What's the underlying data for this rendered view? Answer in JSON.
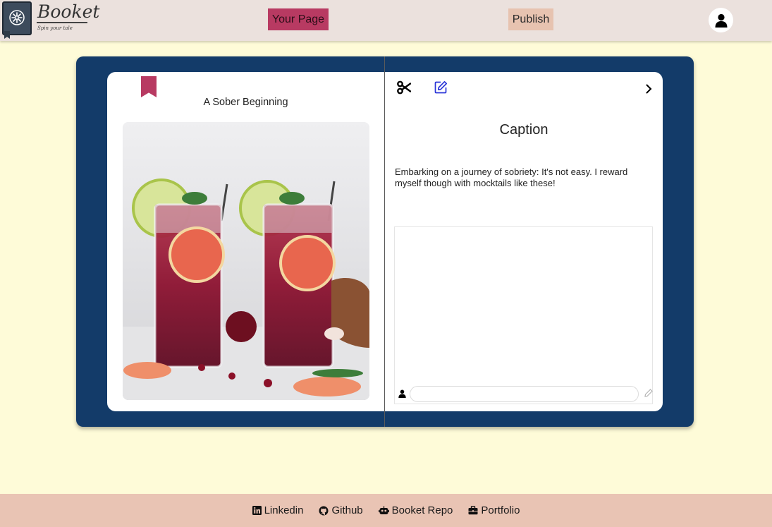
{
  "header": {
    "logo_title": "Booket",
    "logo_tagline": "Spin your tale",
    "your_page_label": "Your Page",
    "publish_label": "Publish"
  },
  "book": {
    "story_title": "A Sober Beginning",
    "caption_heading": "Caption",
    "caption_text": "Embarking on a journey of sobriety: It's not easy. I reward myself though with mocktails like these!",
    "comment_placeholder": ""
  },
  "footer": {
    "links": [
      {
        "label": "Linkedin",
        "icon": "linkedin-icon"
      },
      {
        "label": "Github",
        "icon": "github-icon"
      },
      {
        "label": "Booket Repo",
        "icon": "robot-icon"
      },
      {
        "label": "Portfolio",
        "icon": "briefcase-icon"
      }
    ]
  },
  "colors": {
    "background": "#fefbd8",
    "navbar": "#ebe1dd",
    "accent": "#b83a62",
    "publish": "#e7c3b0",
    "book_cover": "#133b69",
    "footer": "#e9c4b4",
    "edit_icon": "#2a35d8"
  }
}
